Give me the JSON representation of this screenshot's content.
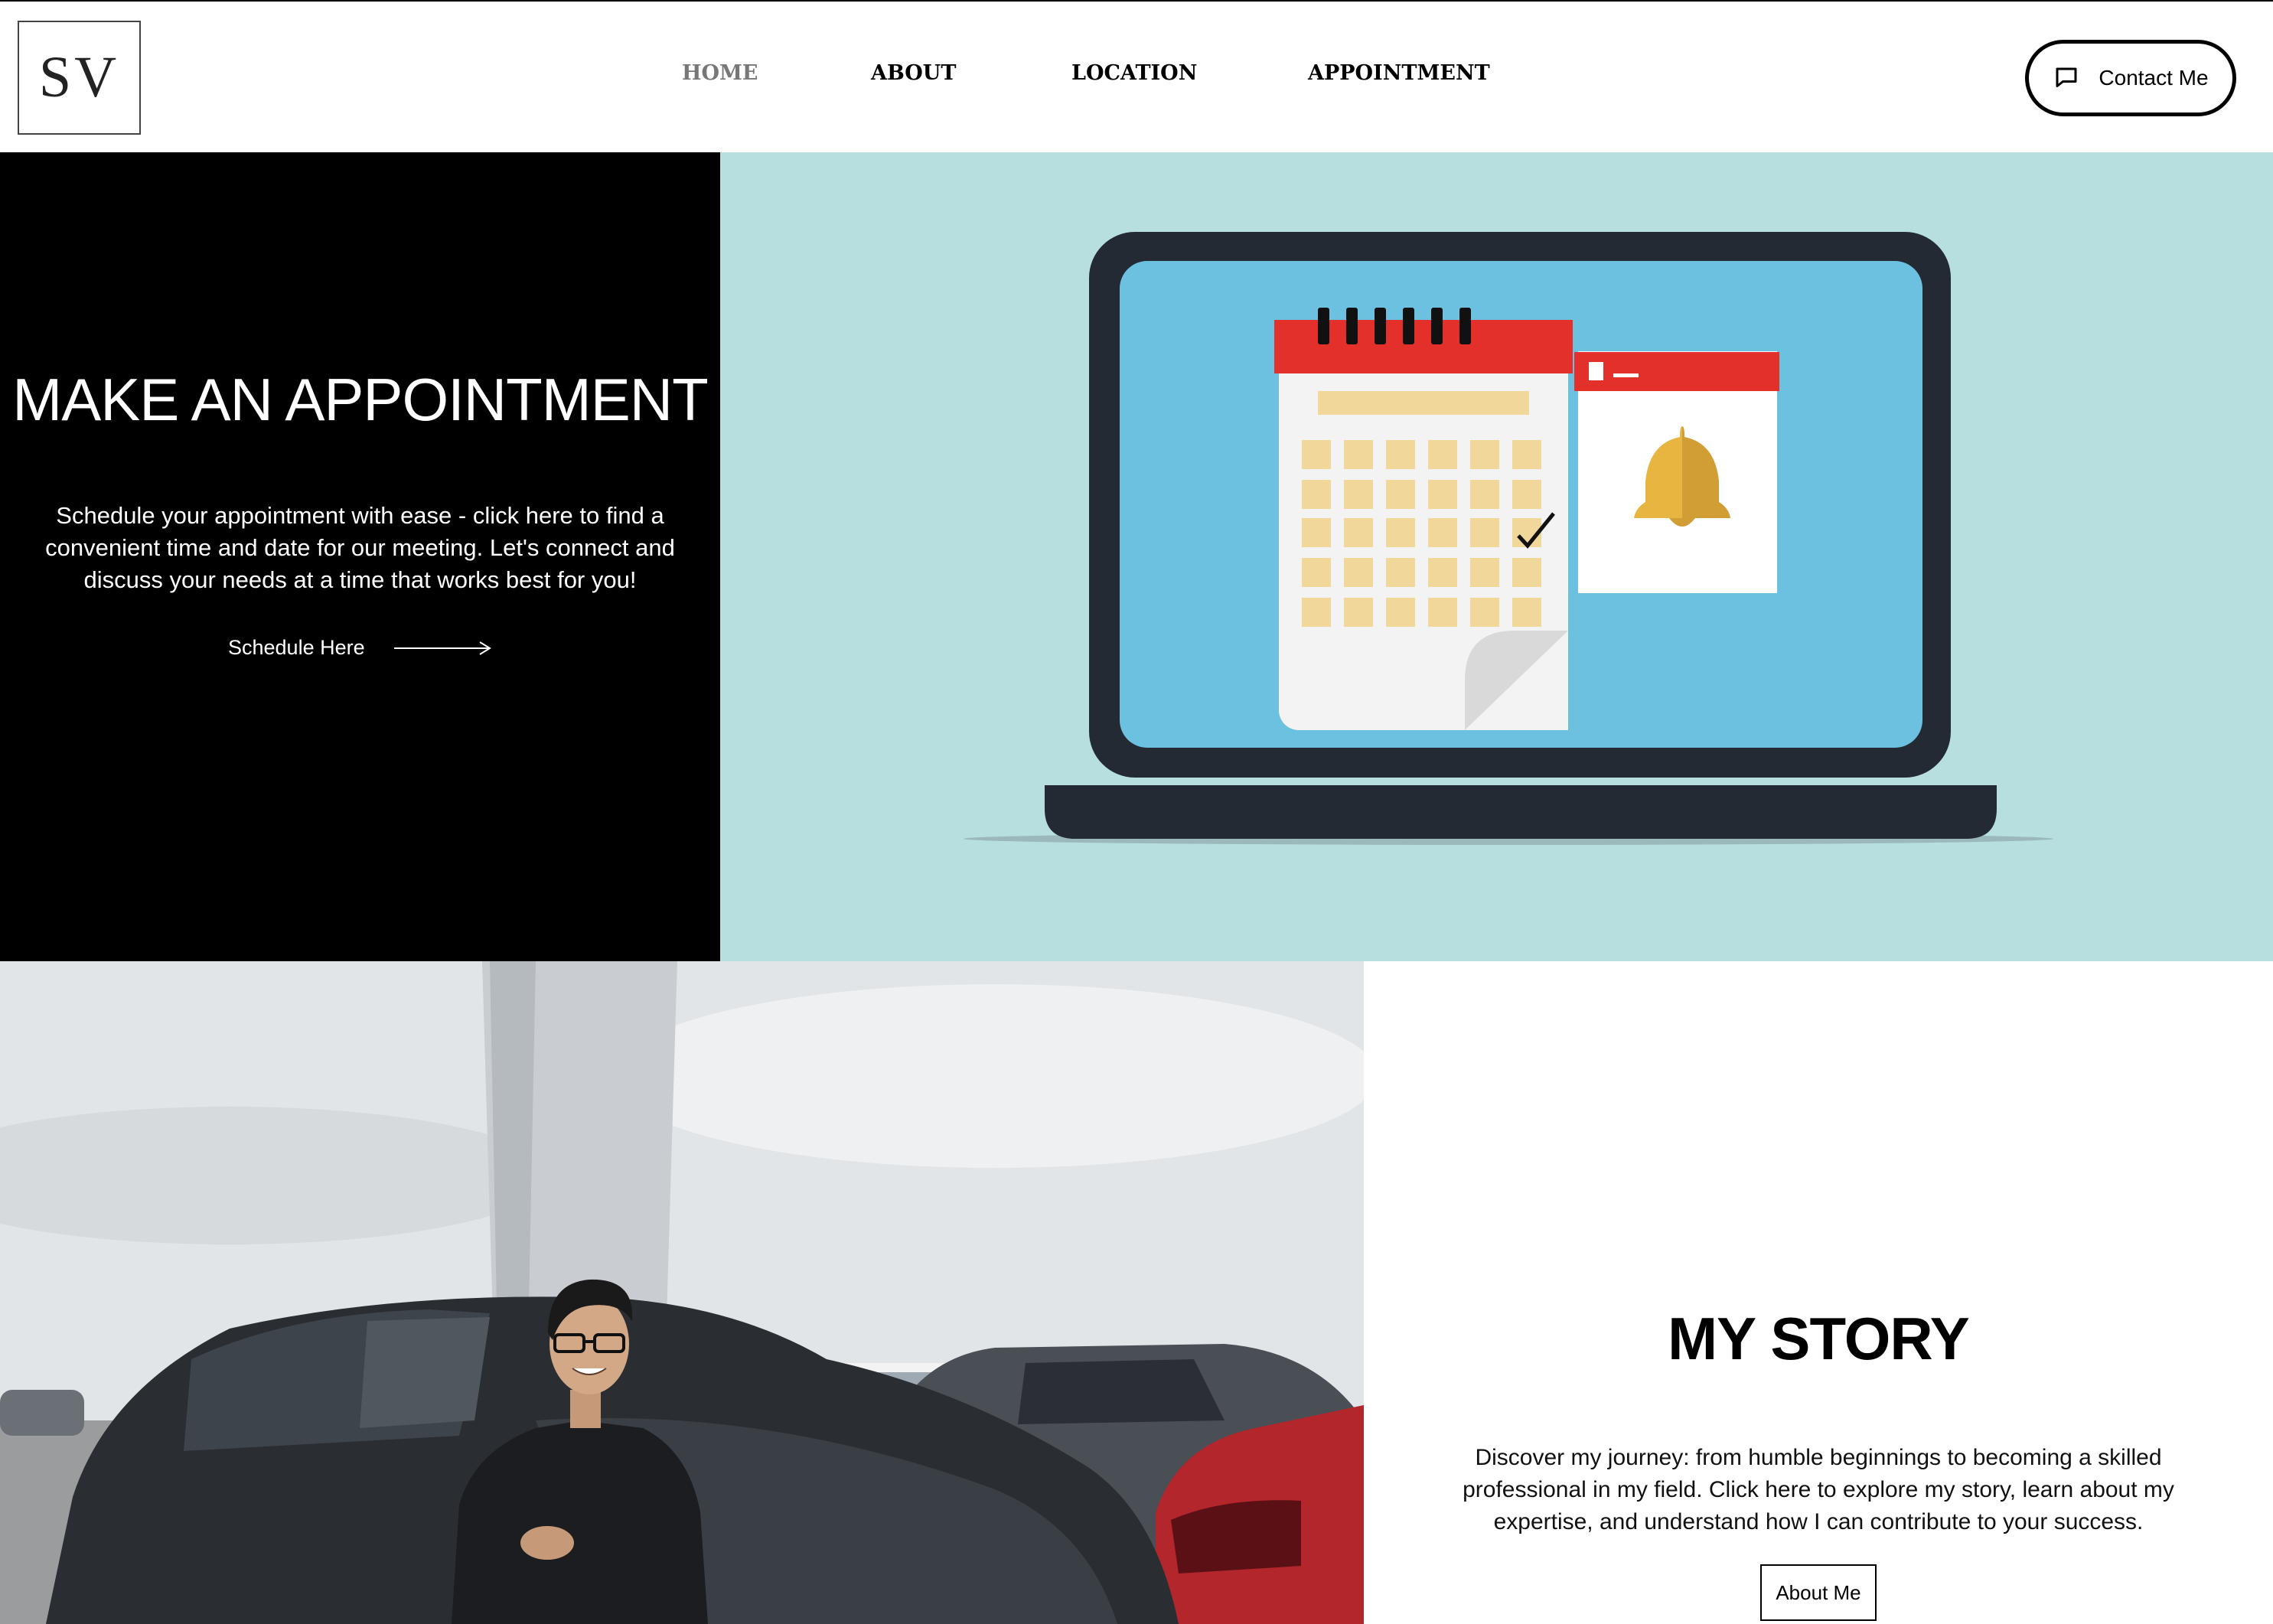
{
  "header": {
    "logo_text": "SV",
    "nav": [
      {
        "label": "HOME",
        "active": true
      },
      {
        "label": "ABOUT",
        "active": false
      },
      {
        "label": "LOCATION",
        "active": false
      },
      {
        "label": "APPOINTMENT",
        "active": false
      }
    ],
    "contact_button": {
      "label": "Contact Me",
      "icon": "chat-bubble-icon"
    }
  },
  "appointment": {
    "title": "MAKE AN APPOINTMENT",
    "description": "Schedule your appointment with ease - click here to find a convenient time and date for our meeting. Let's connect and discuss your needs at a time that works best for you!",
    "link_label": "Schedule Here",
    "link_icon": "arrow-right-icon",
    "illustration": "laptop-calendar-bell-illustration"
  },
  "story": {
    "photo": "man-leaning-on-car-photo",
    "title": "MY STORY",
    "description": "Discover my journey: from humble beginnings to becoming a skilled professional in my field. Click here to explore my story, learn about my expertise, and understand how I can contribute to your success.",
    "button_label": "About Me"
  },
  "colors": {
    "accent_black": "#000000",
    "illustration_bg": "#b8dfe0",
    "screen_blue": "#6cc1e0",
    "calendar_red": "#e3302a",
    "bell_gold": "#e8b541"
  }
}
